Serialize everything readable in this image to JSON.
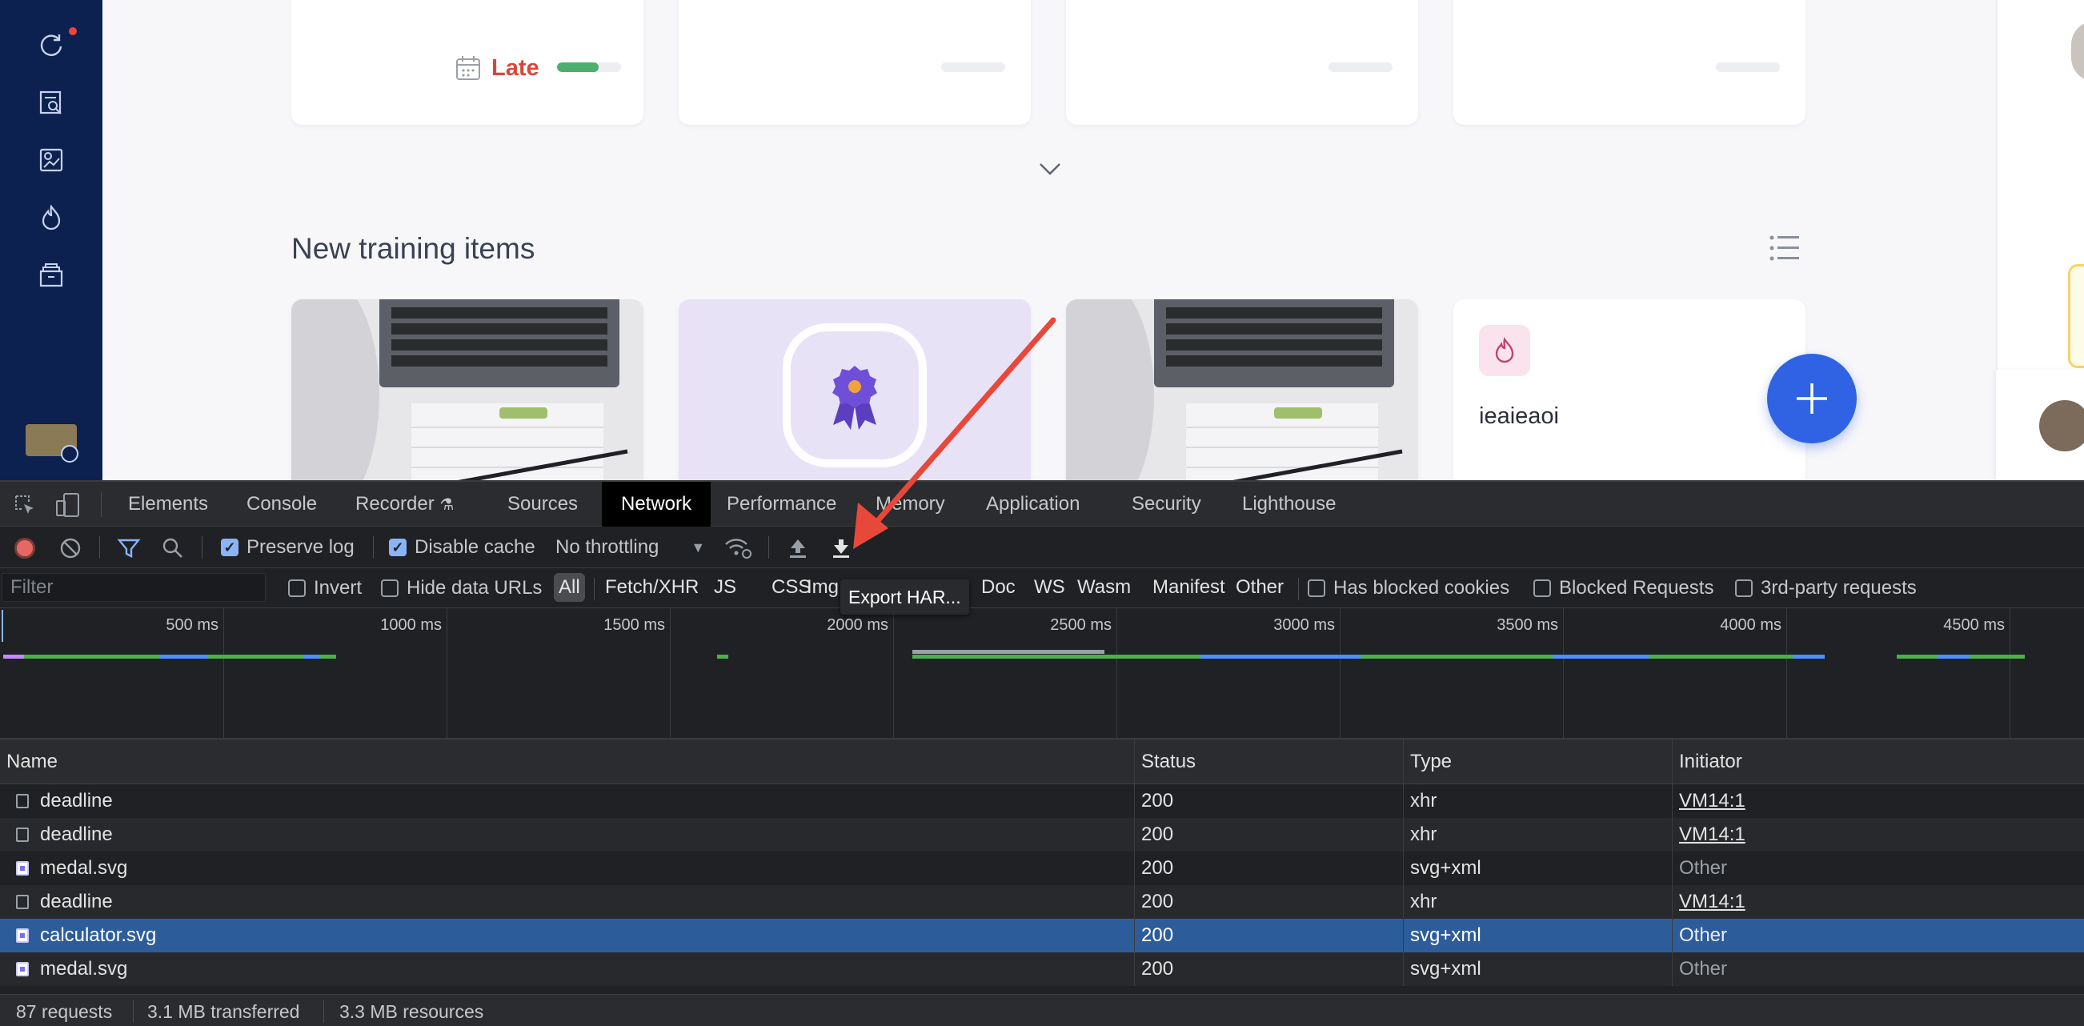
{
  "app": {
    "card_late_label": "Late",
    "card_late_progress": 0.65,
    "section_title": "New training items",
    "new_item_card_title": "ieaieaoi",
    "fab_label": "+",
    "colors": {
      "rail": "#0c2150",
      "late": "#d9473a",
      "fab": "#2f63e3"
    }
  },
  "devtools": {
    "tabs": [
      "Elements",
      "Console",
      "Recorder",
      "Sources",
      "Network",
      "Performance",
      "Memory",
      "Application",
      "Security",
      "Lighthouse"
    ],
    "active_tab": "Network",
    "toolbar": {
      "preserve_log": "Preserve log",
      "disable_cache": "Disable cache",
      "throttling": "No throttling",
      "export_tooltip": "Export HAR..."
    },
    "filter": {
      "placeholder": "Filter",
      "invert": "Invert",
      "hide_data_urls": "Hide data URLs",
      "types": [
        "All",
        "Fetch/XHR",
        "JS",
        "CSS",
        "Img",
        "Media",
        "Font",
        "Doc",
        "WS",
        "Wasm",
        "Manifest",
        "Other"
      ],
      "has_blocked_cookies": "Has blocked cookies",
      "blocked_requests": "Blocked Requests",
      "third_party": "3rd-party requests"
    },
    "timeline_ticks": [
      "500 ms",
      "1000 ms",
      "1500 ms",
      "2000 ms",
      "2500 ms",
      "3000 ms",
      "3500 ms",
      "4000 ms",
      "4500 ms"
    ],
    "columns": [
      "Name",
      "Status",
      "Type",
      "Initiator"
    ],
    "rows": [
      {
        "name": "deadline",
        "status": "200",
        "type": "xhr",
        "initiator": "VM14:1",
        "icon": "doc"
      },
      {
        "name": "deadline",
        "status": "200",
        "type": "xhr",
        "initiator": "VM14:1",
        "icon": "doc"
      },
      {
        "name": "medal.svg",
        "status": "200",
        "type": "svg+xml",
        "initiator": "Other",
        "icon": "img"
      },
      {
        "name": "deadline",
        "status": "200",
        "type": "xhr",
        "initiator": "VM14:1",
        "icon": "doc"
      },
      {
        "name": "calculator.svg",
        "status": "200",
        "type": "svg+xml",
        "initiator": "Other",
        "icon": "img"
      },
      {
        "name": "medal.svg",
        "status": "200",
        "type": "svg+xml",
        "initiator": "Other",
        "icon": "img"
      }
    ],
    "status_bar": {
      "requests": "87 requests",
      "transferred": "3.1 MB transferred",
      "resources": "3.3 MB resources"
    }
  }
}
